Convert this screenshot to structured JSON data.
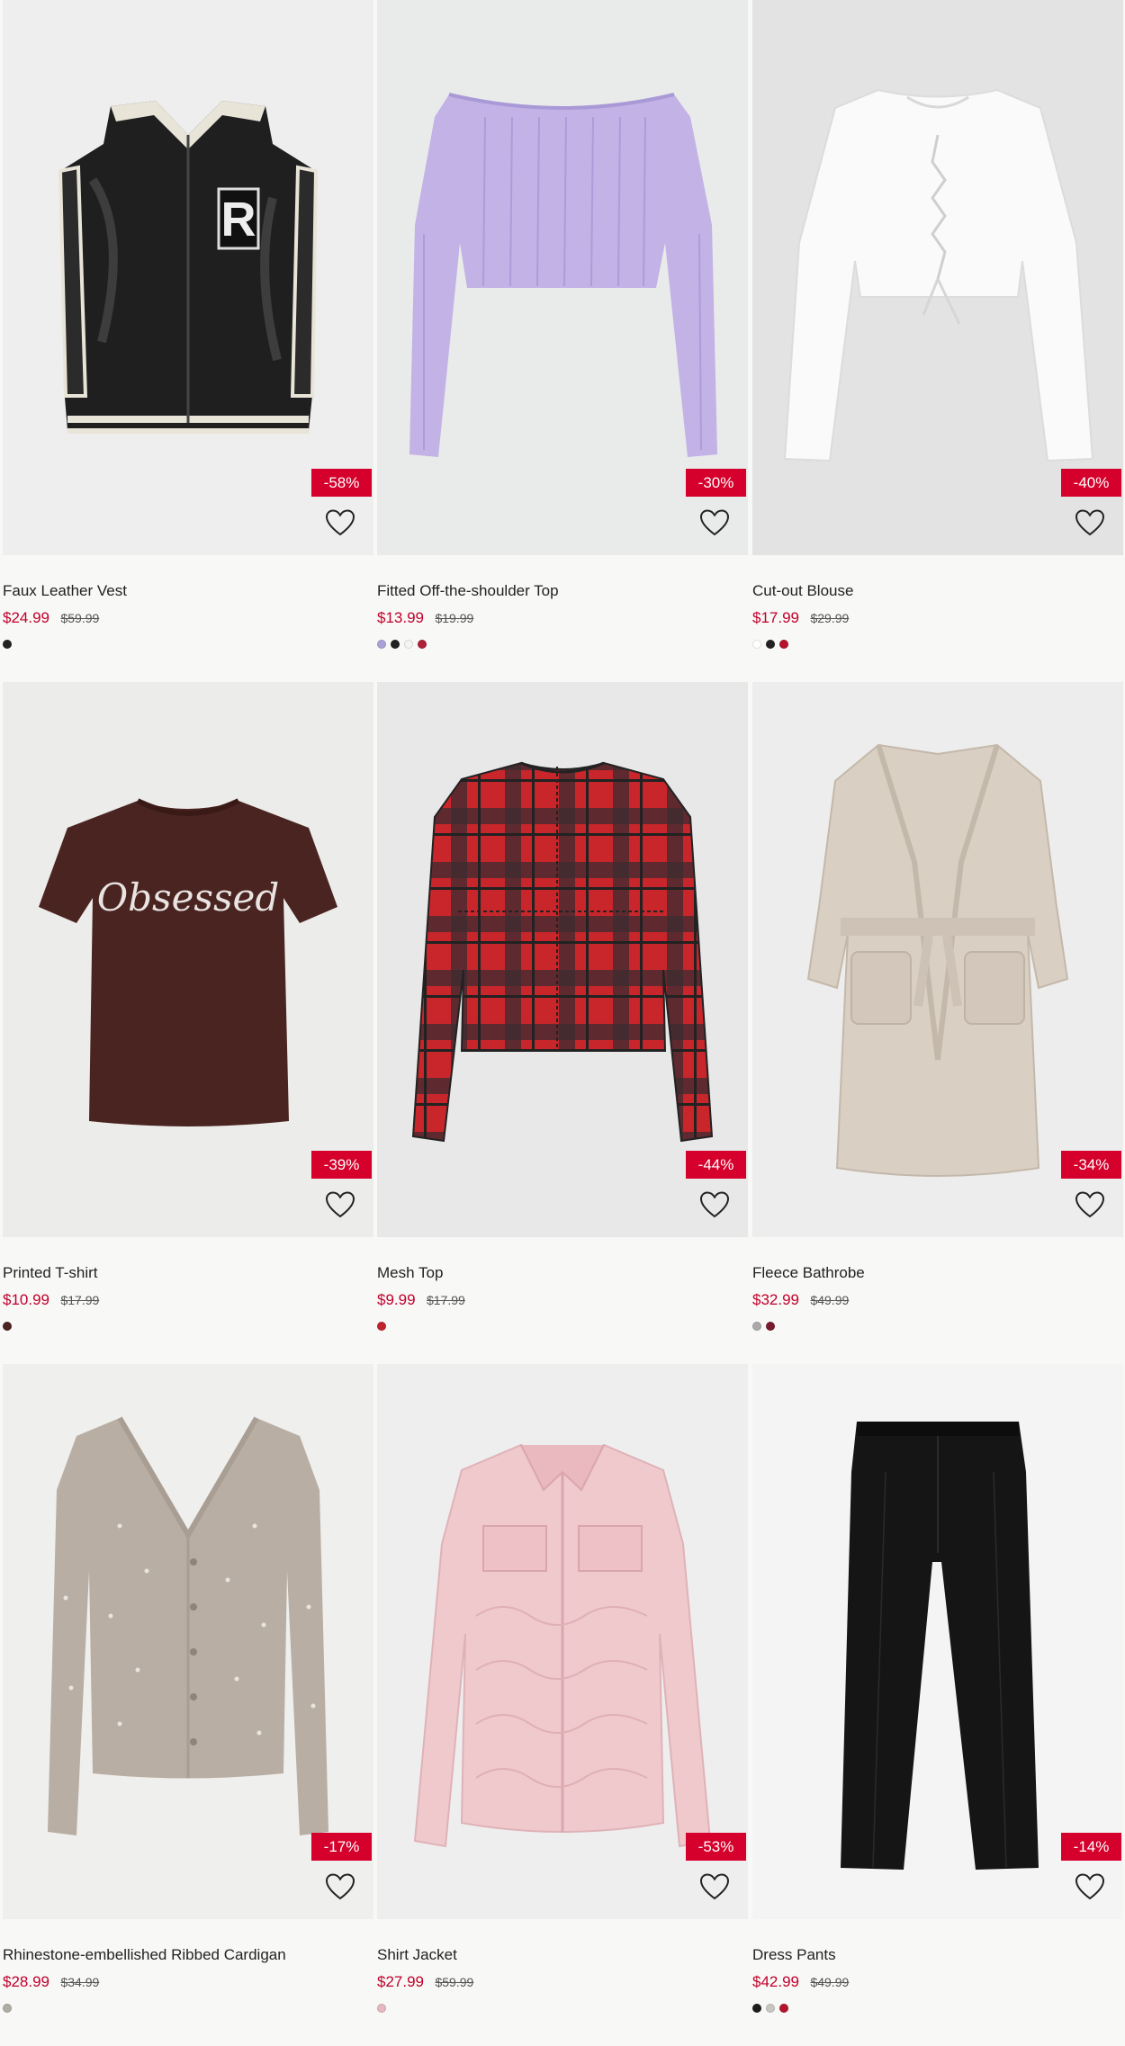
{
  "products": [
    {
      "name": "Faux Leather Vest",
      "price": "$24.99",
      "original_price": "$59.99",
      "discount": "-58%",
      "swatches": [
        "#222222"
      ],
      "bg": "#eeeeee",
      "icon": "vest-image"
    },
    {
      "name": "Fitted Off-the-shoulder Top",
      "price": "$13.99",
      "original_price": "$19.99",
      "discount": "-30%",
      "swatches": [
        "#a9a2d6",
        "#222222",
        "#f4f4f4",
        "#b0203a"
      ],
      "bg": "#e9eaea",
      "icon": "top-image"
    },
    {
      "name": "Cut-out Blouse",
      "price": "$17.99",
      "original_price": "$29.99",
      "discount": "-40%",
      "swatches": [
        "#ffffff",
        "#222222",
        "#b5132c"
      ],
      "bg": "#e3e3e3",
      "icon": "blouse-image"
    },
    {
      "name": "Printed T-shirt",
      "price": "$10.99",
      "original_price": "$17.99",
      "discount": "-39%",
      "swatches": [
        "#4a2420"
      ],
      "bg": "#ececeb",
      "icon": "tshirt-image"
    },
    {
      "name": "Mesh Top",
      "price": "$9.99",
      "original_price": "$17.99",
      "discount": "-44%",
      "swatches": [
        "#c1242c"
      ],
      "bg": "#e8e8e8",
      "icon": "mesh-top-image"
    },
    {
      "name": "Fleece Bathrobe",
      "price": "$32.99",
      "original_price": "$49.99",
      "discount": "-34%",
      "swatches": [
        "#aaaaaa",
        "#7a1a2e"
      ],
      "bg": "#ededed",
      "icon": "bathrobe-image"
    },
    {
      "name": "Rhinestone-embellished Ribbed Cardigan",
      "price": "$28.99",
      "original_price": "$34.99",
      "discount": "-17%",
      "swatches": [
        "#b0aca6"
      ],
      "bg": "#efefee",
      "icon": "cardigan-image"
    },
    {
      "name": "Shirt Jacket",
      "price": "$27.99",
      "original_price": "$59.99",
      "discount": "-53%",
      "swatches": [
        "#e6b8bf"
      ],
      "bg": "#eeeeee",
      "icon": "jacket-image"
    },
    {
      "name": "Dress Pants",
      "price": "$42.99",
      "original_price": "$49.99",
      "discount": "-14%",
      "swatches": [
        "#1d1d1d",
        "#c9c6c1",
        "#b5132c"
      ],
      "bg": "#f4f4f4",
      "icon": "pants-image"
    }
  ]
}
